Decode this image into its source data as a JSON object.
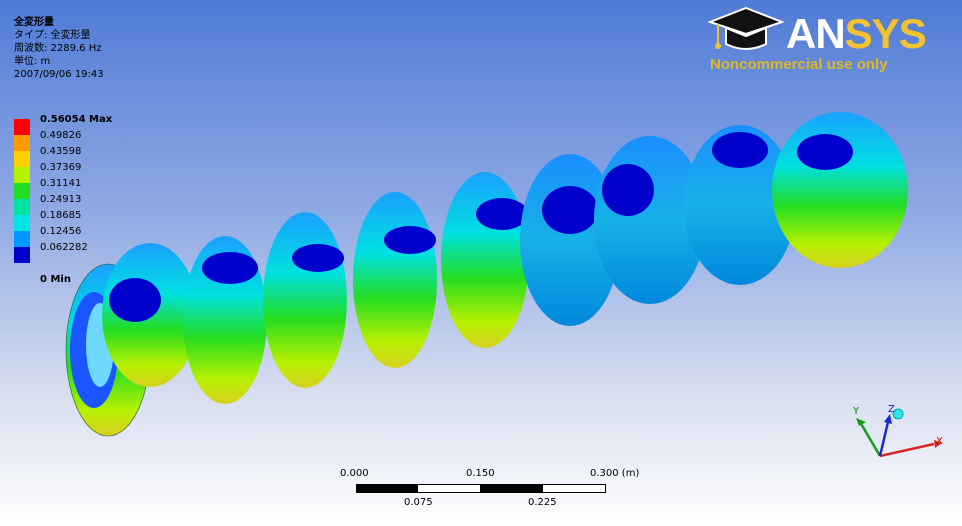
{
  "info": {
    "title": "全変形量",
    "type_line": "タイプ: 全変形量",
    "freq_line": "周波数: 2289.6 Hz",
    "unit_line": "単位: m",
    "date_line": "2007/09/06 19:43"
  },
  "legend": {
    "max_label": "0.56054 Max",
    "min_label": "0 Min",
    "labels": [
      "0.49826",
      "0.43598",
      "0.37369",
      "0.31141",
      "0.24913",
      "0.18685",
      "0.12456",
      "0.062282"
    ],
    "colors": [
      "#ff0000",
      "#ff9900",
      "#ffd000",
      "#b7f000",
      "#22dd22",
      "#00e6a0",
      "#00e6e6",
      "#0099ff",
      "#0000cc"
    ]
  },
  "logo": {
    "brand_main": "AN",
    "brand_accent": "SYS",
    "note": "Noncommercial use only"
  },
  "scale": {
    "top_labels": [
      "0.000",
      "0.150",
      "0.300 (m)"
    ],
    "bottom_labels": [
      "0.075",
      "0.225"
    ]
  },
  "triad": {
    "x": "X",
    "y": "Y",
    "z": "Z"
  }
}
